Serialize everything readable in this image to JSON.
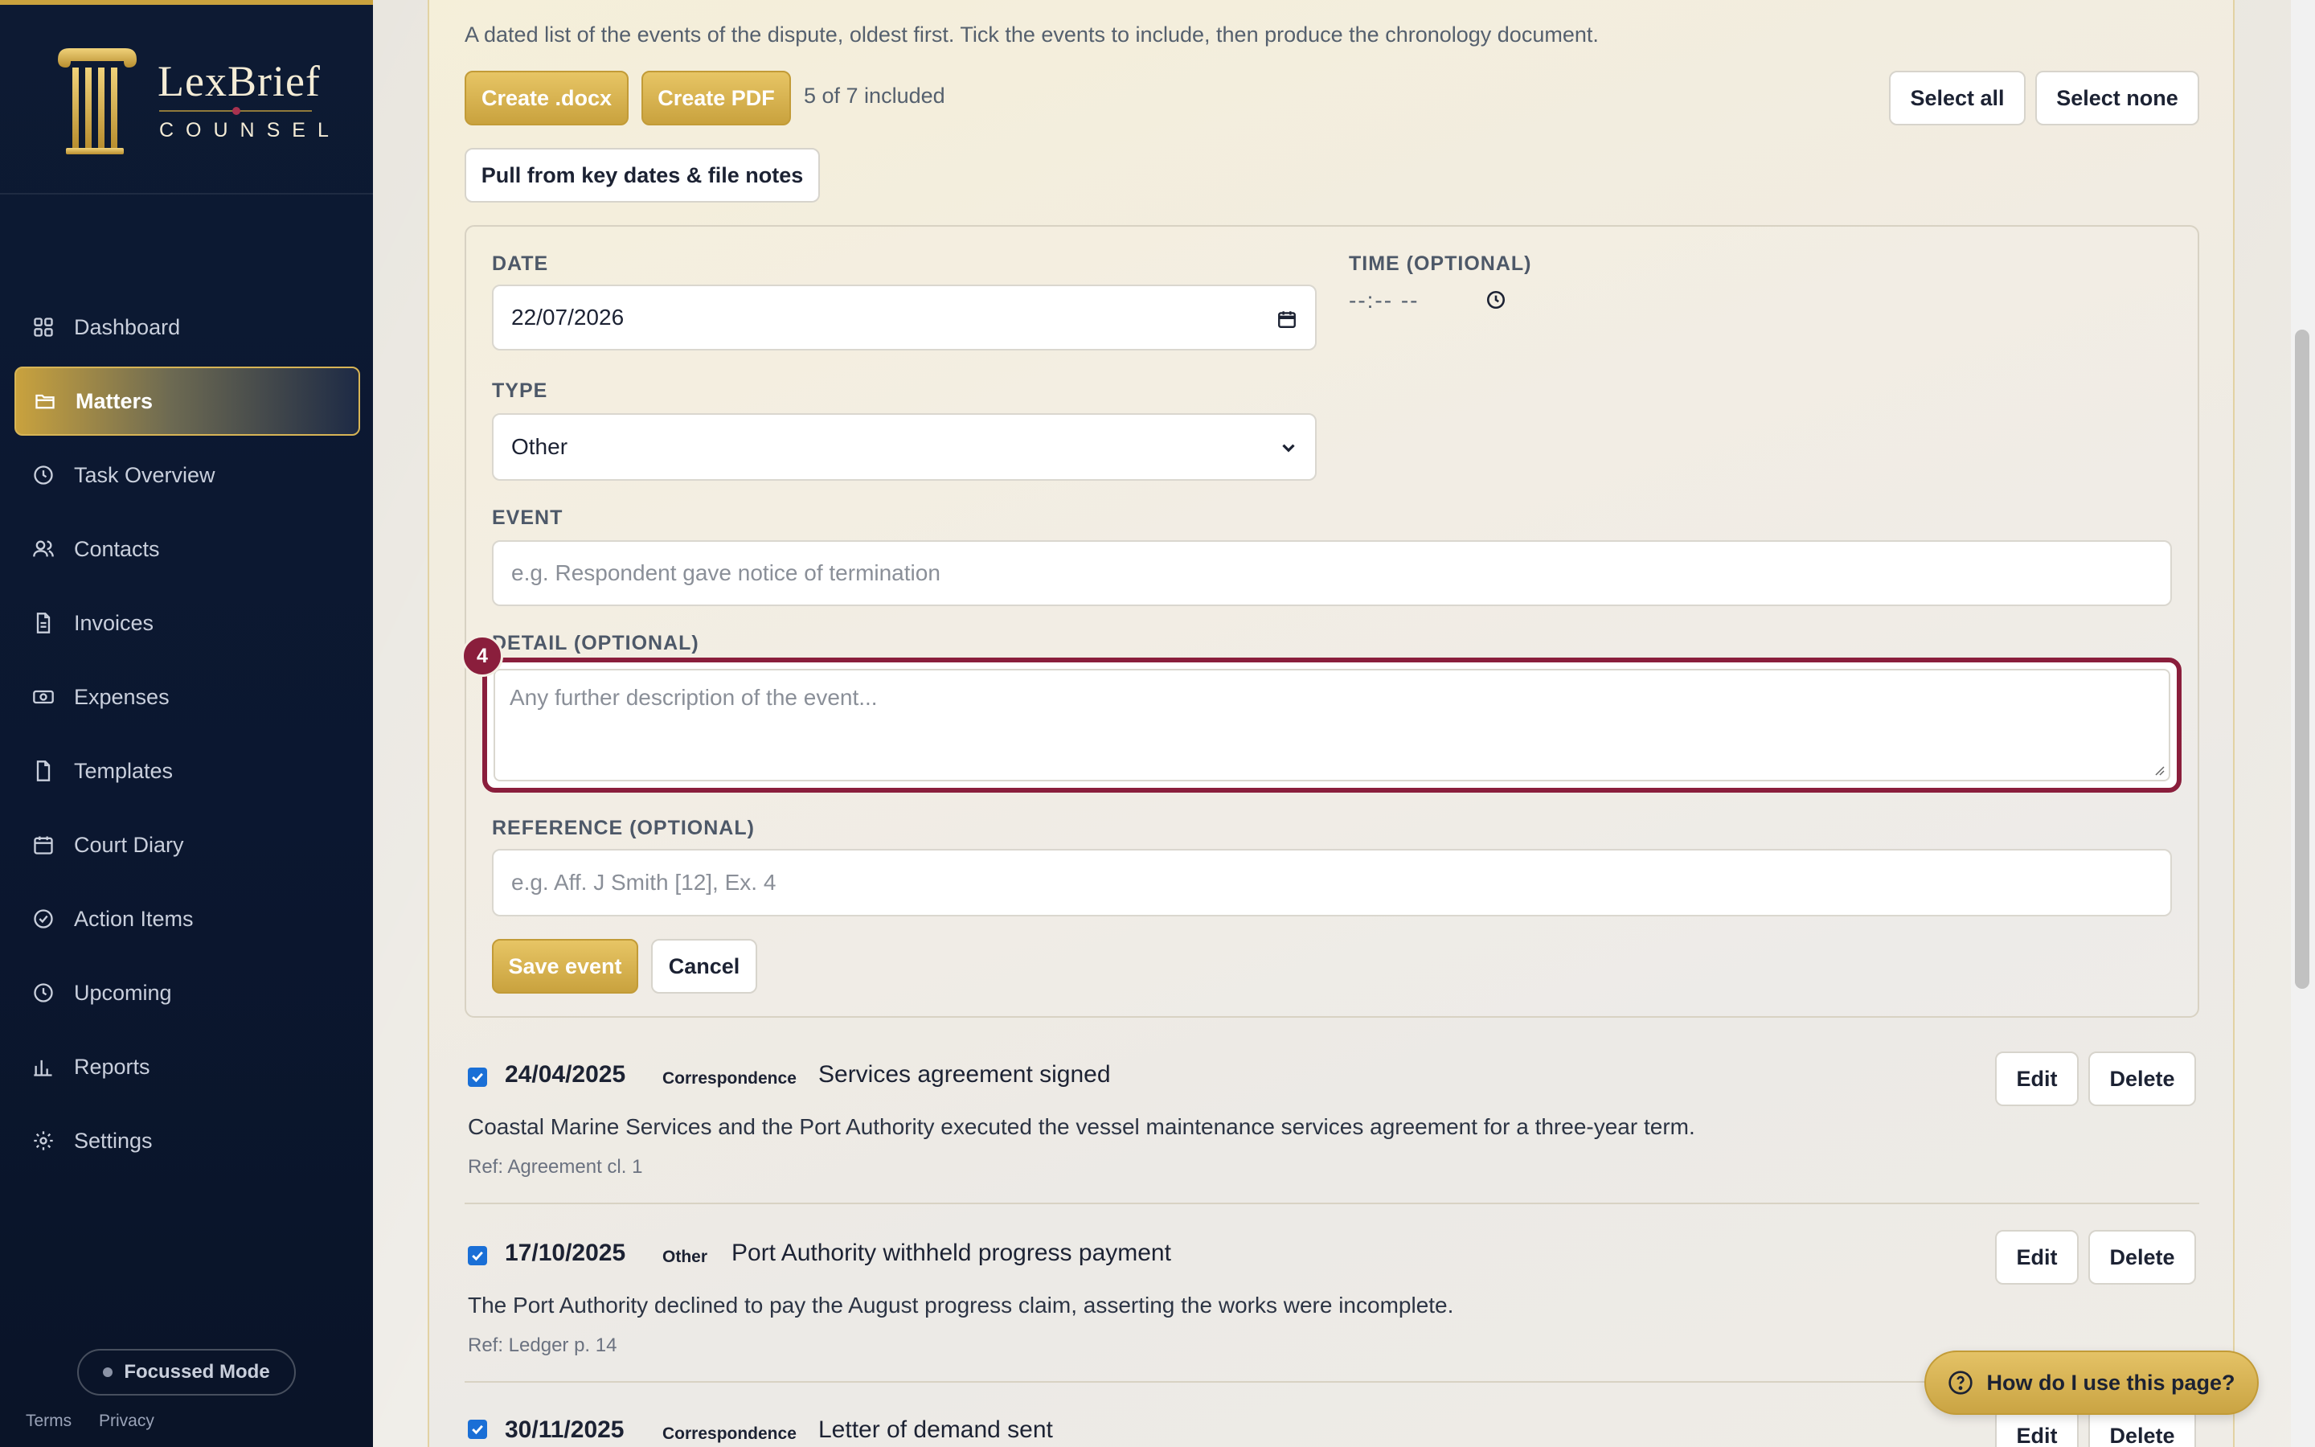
{
  "brand": {
    "name": "LexBrief",
    "sub": "COUNSEL"
  },
  "sidebar": {
    "items": [
      {
        "label": "Dashboard",
        "icon": "grid-icon"
      },
      {
        "label": "Matters",
        "icon": "folder-icon",
        "active": true
      },
      {
        "label": "Task Overview",
        "icon": "clock-icon"
      },
      {
        "label": "Contacts",
        "icon": "users-icon"
      },
      {
        "label": "Invoices",
        "icon": "document-icon"
      },
      {
        "label": "Expenses",
        "icon": "banknote-icon"
      },
      {
        "label": "Templates",
        "icon": "file-icon"
      },
      {
        "label": "Court Diary",
        "icon": "calendar-icon"
      },
      {
        "label": "Action Items",
        "icon": "check-circle-icon"
      },
      {
        "label": "Upcoming",
        "icon": "clock-icon"
      },
      {
        "label": "Reports",
        "icon": "bar-chart-icon"
      },
      {
        "label": "Settings",
        "icon": "gear-icon"
      }
    ],
    "focus_mode": "Focussed Mode",
    "footer": {
      "terms": "Terms",
      "privacy": "Privacy"
    }
  },
  "main": {
    "intro": "A dated list of the events of the dispute, oldest first. Tick the events to include, then produce the chronology document.",
    "create_docx": "Create .docx",
    "create_pdf": "Create PDF",
    "included_count": "5 of 7 included",
    "select_all": "Select all",
    "select_none": "Select none",
    "pull_from": "Pull from key dates & file notes"
  },
  "form": {
    "date_label": "DATE",
    "date_value": "22/07/2026",
    "time_label": "TIME (OPTIONAL)",
    "time_value": "--:-- --",
    "type_label": "TYPE",
    "type_value": "Other",
    "event_label": "EVENT",
    "event_placeholder": "e.g. Respondent gave notice of termination",
    "detail_label": "DETAIL (OPTIONAL)",
    "detail_placeholder": "Any further description of the event...",
    "reference_label": "REFERENCE (OPTIONAL)",
    "reference_placeholder": "e.g. Aff. J Smith [12], Ex. 4",
    "save": "Save event",
    "cancel": "Cancel",
    "step_badge": "4"
  },
  "events": [
    {
      "checked": true,
      "date": "24/04/2025",
      "type": "Correspondence",
      "title": "Services agreement signed",
      "description": "Coastal Marine Services and the Port Authority executed the vessel maintenance services agreement for a three-year term.",
      "ref": "Ref: Agreement cl. 1"
    },
    {
      "checked": true,
      "date": "17/10/2025",
      "type": "Other",
      "title": "Port Authority withheld progress payment",
      "description": "The Port Authority declined to pay the August progress claim, asserting the works were incomplete.",
      "ref": "Ref: Ledger p. 14"
    },
    {
      "checked": true,
      "date": "30/11/2025",
      "type": "Correspondence",
      "title": "Letter of demand sent",
      "description": "",
      "ref": ""
    }
  ],
  "event_actions": {
    "edit": "Edit",
    "delete": "Delete"
  },
  "help": "How do I use this page?",
  "colors": {
    "sidebar_bg": "#0b1730",
    "gold": "#c9a23e",
    "highlight": "#8a1e3c",
    "checkbox": "#1a6fd6"
  }
}
